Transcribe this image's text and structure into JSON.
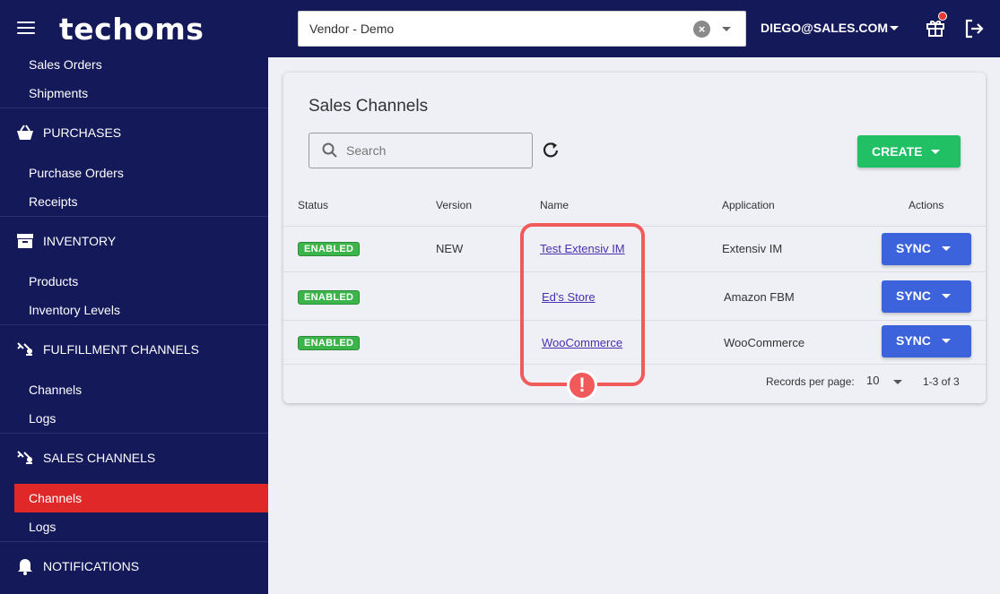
{
  "header": {
    "logo": "techoms",
    "vendor": "Vendor - Demo",
    "user": "DIEGO@SALES.COM"
  },
  "sidebar": {
    "items": [
      {
        "label": "Sales Orders"
      },
      {
        "label": "Shipments"
      },
      {
        "label": "PURCHASES"
      },
      {
        "label": "Purchase Orders"
      },
      {
        "label": "Receipts"
      },
      {
        "label": "INVENTORY"
      },
      {
        "label": "Products"
      },
      {
        "label": "Inventory Levels"
      },
      {
        "label": "FULFILLMENT CHANNELS"
      },
      {
        "label": "Channels"
      },
      {
        "label": "Logs"
      },
      {
        "label": "SALES CHANNELS"
      },
      {
        "label": "Channels"
      },
      {
        "label": "Logs"
      },
      {
        "label": "NOTIFICATIONS"
      }
    ],
    "active_color": "#e02828"
  },
  "main": {
    "title": "Sales Channels",
    "search_placeholder": "Search",
    "create_label": "CREATE",
    "columns": [
      "Status",
      "Version",
      "Name",
      "Application",
      "Actions"
    ],
    "rows": [
      {
        "status": "ENABLED",
        "version": "NEW",
        "name": "Test Extensiv IM",
        "application": "Extensiv IM",
        "action": "SYNC"
      },
      {
        "status": "ENABLED",
        "version": "",
        "name": "Ed's Store",
        "application": "Amazon FBM",
        "action": "SYNC"
      },
      {
        "status": "ENABLED",
        "version": "",
        "name": "WooCommerce",
        "application": "WooCommerce",
        "action": "SYNC"
      }
    ],
    "pager": {
      "label": "Records per page:",
      "per_page": "10",
      "range": "1-3 of 3"
    }
  },
  "annotation": {
    "mark": "!",
    "color": "#f05a5a"
  },
  "colors": {
    "nav": "#14195a",
    "create": "#21c064",
    "sync": "#3d63dc",
    "enabled": "#3bb54a"
  }
}
